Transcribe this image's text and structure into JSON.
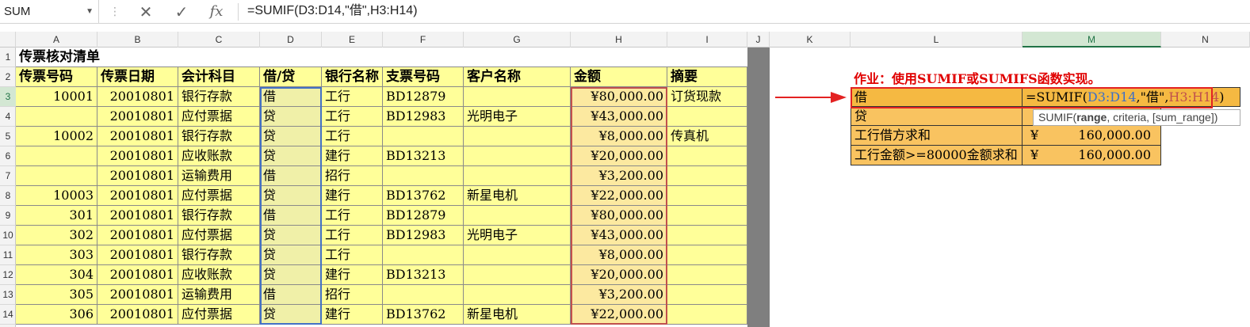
{
  "formula_bar": {
    "name_box": "SUM",
    "cancel_glyph": "✕",
    "enter_glyph": "✓",
    "fx_label": "fx",
    "formula": "=SUMIF(D3:D14,\"借\",H3:H14)"
  },
  "columns": [
    "A",
    "B",
    "C",
    "D",
    "E",
    "F",
    "G",
    "H",
    "I",
    "J",
    "K",
    "L",
    "M",
    "N"
  ],
  "sheet": {
    "title": "传票核对清单",
    "headers": [
      "传票号码",
      "传票日期",
      "会计科目",
      "借/贷",
      "银行名称",
      "支票号码",
      "客户名称",
      "金额",
      "摘要"
    ],
    "rows": [
      {
        "row": "3",
        "no": "10001",
        "date": "20010801",
        "account": "银行存款",
        "dc": "借",
        "bank": "工行",
        "cheque": "BD12879",
        "customer": "",
        "amount": "¥80,000.00",
        "memo": "订货现款"
      },
      {
        "row": "4",
        "no": "",
        "date": "20010801",
        "account": "应付票据",
        "dc": "贷",
        "bank": "工行",
        "cheque": "BD12983",
        "customer": "光明电子",
        "amount": "¥43,000.00",
        "memo": ""
      },
      {
        "row": "5",
        "no": "10002",
        "date": "20010801",
        "account": "银行存款",
        "dc": "贷",
        "bank": "工行",
        "cheque": "",
        "customer": "",
        "amount": "¥8,000.00",
        "memo": "传真机"
      },
      {
        "row": "6",
        "no": "",
        "date": "20010801",
        "account": "应收账款",
        "dc": "贷",
        "bank": "建行",
        "cheque": "BD13213",
        "customer": "",
        "amount": "¥20,000.00",
        "memo": ""
      },
      {
        "row": "7",
        "no": "",
        "date": "20010801",
        "account": "运输费用",
        "dc": "借",
        "bank": "招行",
        "cheque": "",
        "customer": "",
        "amount": "¥3,200.00",
        "memo": ""
      },
      {
        "row": "8",
        "no": "10003",
        "date": "20010801",
        "account": "应付票据",
        "dc": "贷",
        "bank": "建行",
        "cheque": "BD13762",
        "customer": "新星电机",
        "amount": "¥22,000.00",
        "memo": ""
      },
      {
        "row": "9",
        "no": "301",
        "date": "20010801",
        "account": "银行存款",
        "dc": "借",
        "bank": "工行",
        "cheque": "BD12879",
        "customer": "",
        "amount": "¥80,000.00",
        "memo": ""
      },
      {
        "row": "10",
        "no": "302",
        "date": "20010801",
        "account": "应付票据",
        "dc": "贷",
        "bank": "工行",
        "cheque": "BD12983",
        "customer": "光明电子",
        "amount": "¥43,000.00",
        "memo": ""
      },
      {
        "row": "11",
        "no": "303",
        "date": "20010801",
        "account": "银行存款",
        "dc": "贷",
        "bank": "工行",
        "cheque": "",
        "customer": "",
        "amount": "¥8,000.00",
        "memo": ""
      },
      {
        "row": "12",
        "no": "304",
        "date": "20010801",
        "account": "应收账款",
        "dc": "贷",
        "bank": "建行",
        "cheque": "BD13213",
        "customer": "",
        "amount": "¥20,000.00",
        "memo": ""
      },
      {
        "row": "13",
        "no": "305",
        "date": "20010801",
        "account": "运输费用",
        "dc": "借",
        "bank": "招行",
        "cheque": "",
        "customer": "",
        "amount": "¥3,200.00",
        "memo": ""
      },
      {
        "row": "14",
        "no": "306",
        "date": "20010801",
        "account": "应付票据",
        "dc": "贷",
        "bank": "建行",
        "cheque": "BD13762",
        "customer": "新星电机",
        "amount": "¥22,000.00",
        "memo": ""
      }
    ]
  },
  "row_numbers": [
    "1",
    "2"
  ],
  "task": {
    "heading": "作业：使用SUMIF或SUMIFS函数实现。",
    "summary": [
      {
        "label": "借",
        "value": ""
      },
      {
        "label": "贷",
        "value": ""
      },
      {
        "label": "工行借方求和",
        "currency": "¥",
        "value": "160,000.00"
      },
      {
        "label": "工行金额>=80000金额求和",
        "currency": "¥",
        "value": "160,000.00"
      }
    ],
    "editing_formula": {
      "prefix": "=SUMIF(",
      "range1": "D3:D14",
      "sep1": ",",
      "criteria": "\"借\"",
      "sep2": ",",
      "range2": "H3:H14",
      "suffix": ")"
    },
    "tooltip": {
      "fn": "SUMIF(",
      "arg1": "range",
      "rest": ", criteria, [sum_range])"
    }
  }
}
